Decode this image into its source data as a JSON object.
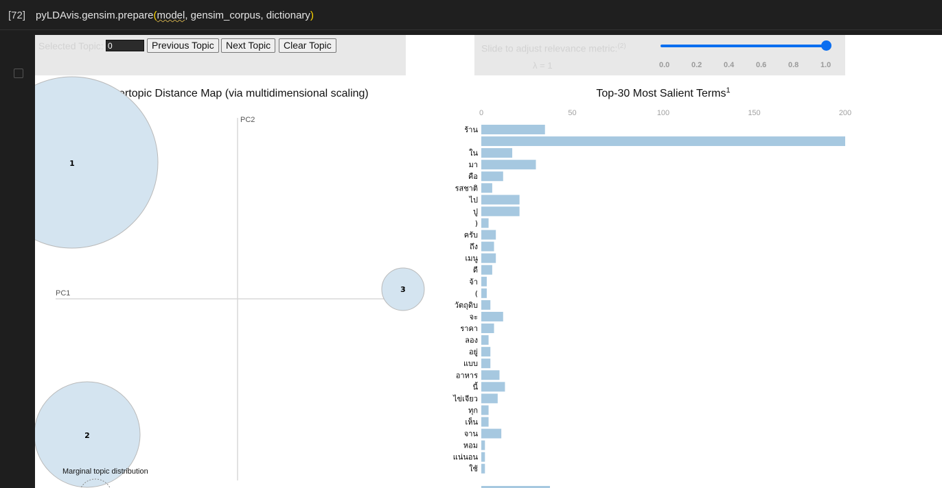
{
  "cell": {
    "exec_count": "[72]",
    "code_prefix": "pyLDAvis.gensim.prepare",
    "code_open": "(",
    "code_arg1": "model",
    "code_rest": ", gensim_corpus, dictionary",
    "code_close": ")"
  },
  "controls": {
    "selected_topic_label": "Selected Topic:",
    "selected_topic_value": "0",
    "previous_label": "Previous Topic",
    "next_label": "Next Topic",
    "clear_label": "Clear Topic",
    "relevance_label": "Slide to adjust relevance metric:",
    "relevance_footnote": "(2)",
    "lambda_label": "λ = 1",
    "slider_value": 1.0,
    "slider_ticks": [
      "0.0",
      "0.2",
      "0.4",
      "0.6",
      "0.8",
      "1.0"
    ]
  },
  "intertopic": {
    "title": "Intertopic Distance Map (via multidimensional scaling)",
    "pc1_label": "PC1",
    "pc2_label": "PC2",
    "marginal_label": "Marginal topic distribution",
    "topics": [
      {
        "label": "1"
      },
      {
        "label": "2"
      },
      {
        "label": "3"
      }
    ]
  },
  "chart_data": {
    "type": "bar",
    "title": "Top-30 Most Salient Terms",
    "title_sup": "1",
    "orientation": "horizontal",
    "xlim": [
      0,
      200
    ],
    "x_ticks": [
      "0",
      "50",
      "100",
      "150",
      "200"
    ],
    "categories": [
      "ร้าน",
      "",
      "ใน",
      "มา",
      "คือ",
      "รสชาติ",
      "ไป",
      "ปู",
      ")",
      "ครับ",
      "ถึง",
      "เมนู",
      "ดี",
      "จ้า",
      "(",
      "วัตถุดิบ",
      "จะ",
      "ราคา",
      "ลอง",
      "อยู่",
      "แบบ",
      "อาหาร",
      "นี้",
      "ไข่เจียว",
      "ทุก",
      "เห็น",
      "จาน",
      "หอม",
      "แน่นอน",
      "ใช้"
    ],
    "values": [
      35,
      200,
      17,
      30,
      12,
      6,
      21,
      21,
      4,
      8,
      7,
      8,
      6,
      3,
      3,
      5,
      12,
      7,
      4,
      5,
      5,
      10,
      13,
      9,
      4,
      4,
      11,
      2,
      2,
      2
    ],
    "bar_color": "#a6c8e0"
  }
}
